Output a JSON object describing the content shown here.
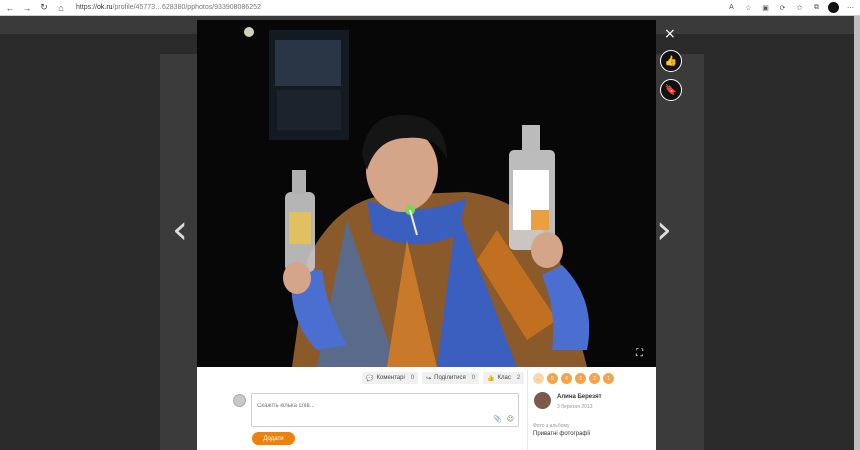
{
  "browser": {
    "url_prefix": "https://",
    "url_host": "ok.ru",
    "url_rest": "/profile/45773…628380/pphotos/933908086252",
    "icons": [
      "back-icon",
      "forward-icon",
      "reload-icon",
      "home-icon",
      "info-icon"
    ]
  },
  "viewer": {
    "prev_arrow": "‹",
    "next_arrow": "›",
    "close_glyph": "×",
    "like_glyph": "👍",
    "bookmark_glyph": "🔖",
    "expand_glyph": "⛶"
  },
  "actions": {
    "comments_label": "Коментарі",
    "comments_count": "0",
    "shares_label": "Поділитися",
    "shares_count": "0",
    "likes_label": "Клас",
    "likes_count": "2"
  },
  "comment": {
    "placeholder": "Скажіть кілька слів...",
    "submit_label": "Додати"
  },
  "ratings": {
    "back_glyph": "←",
    "values": [
      "5",
      "4",
      "3",
      "2",
      "1"
    ]
  },
  "owner": {
    "name": "Алина Березят",
    "date": "3 березня 2013"
  },
  "album": {
    "label": "Фото з альбому",
    "name": "Приватні фотографії"
  },
  "colors": {
    "accent": "#ee8208",
    "rating": "#f5a24a"
  }
}
